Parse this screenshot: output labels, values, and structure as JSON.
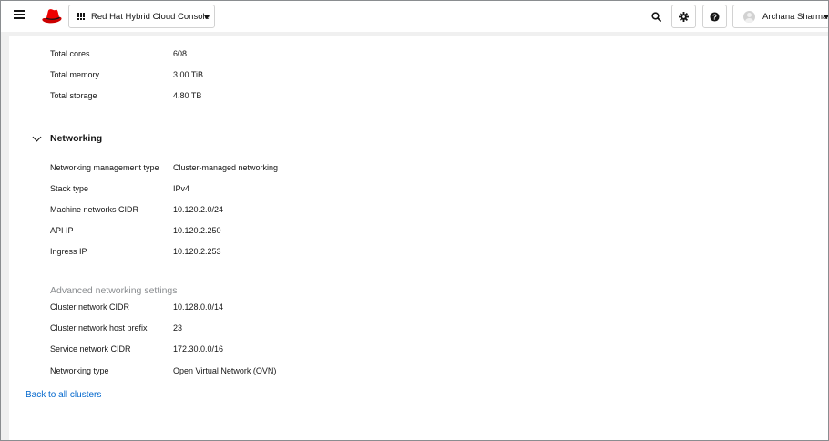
{
  "masthead": {
    "app_switcher_label": "Red Hat Hybrid Cloud Console",
    "user_name": "Archana Sharma",
    "icons": {
      "menu": "hamburger-menu-icon",
      "logo": "redhat-logo",
      "apps": "grid-icon",
      "search": "search-icon",
      "settings": "gear-icon",
      "help": "question-circle-icon",
      "avatar": "user-avatar-icon"
    }
  },
  "resources": [
    {
      "label": "Total cores",
      "value": "608"
    },
    {
      "label": "Total memory",
      "value": "3.00 TiB"
    },
    {
      "label": "Total storage",
      "value": "4.80 TB"
    }
  ],
  "networking": {
    "title": "Networking",
    "rows": [
      {
        "label": "Networking management type",
        "value": "Cluster-managed networking"
      },
      {
        "label": "Stack type",
        "value": "IPv4"
      },
      {
        "label": "Machine networks CIDR",
        "value": "10.120.2.0/24"
      },
      {
        "label": "API IP",
        "value": "10.120.2.250"
      },
      {
        "label": "Ingress IP",
        "value": "10.120.2.253"
      }
    ],
    "advanced_title": "Advanced networking settings",
    "advanced_rows": [
      {
        "label": "Cluster network CIDR",
        "value": "10.128.0.0/14"
      },
      {
        "label": "Cluster network host prefix",
        "value": "23"
      },
      {
        "label": "Service network CIDR",
        "value": "172.30.0.0/16"
      },
      {
        "label": "Networking type",
        "value": "Open Virtual Network (OVN)"
      }
    ]
  },
  "footer": {
    "back_link": "Back to all clusters"
  },
  "colors": {
    "link": "#0066cc",
    "brand_red": "#ee0000",
    "muted": "#8a8d90"
  }
}
